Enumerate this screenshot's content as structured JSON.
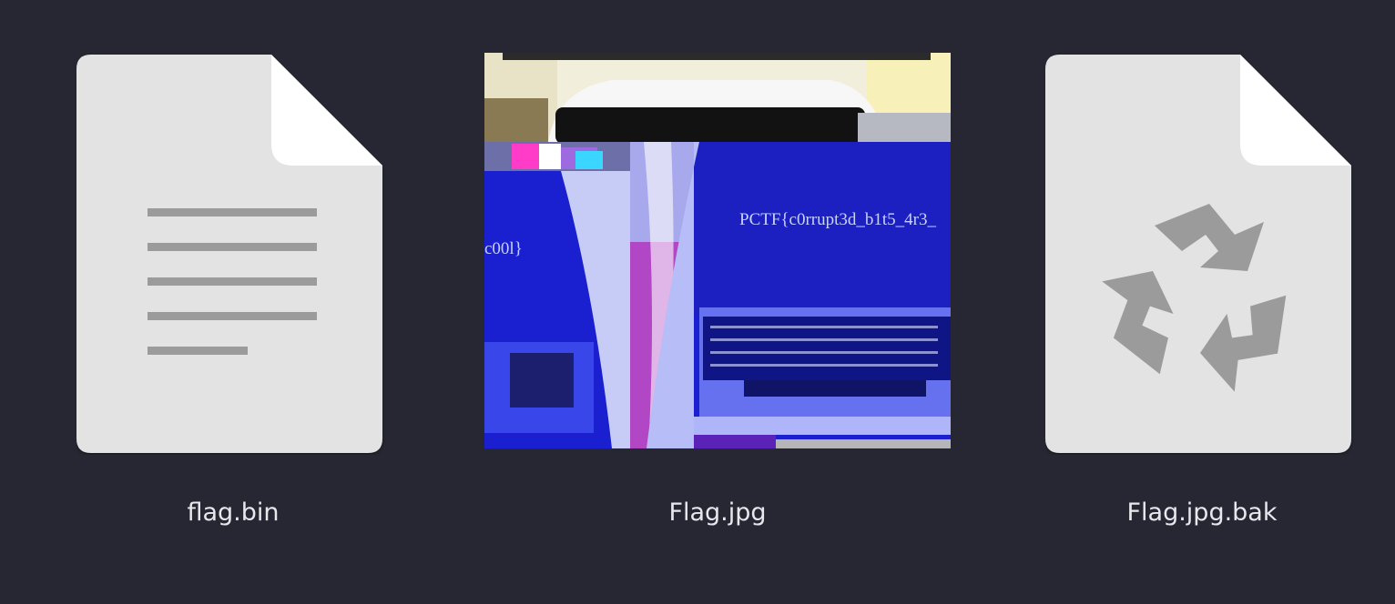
{
  "files": [
    {
      "name": "flag.bin",
      "icon": "text-document-icon"
    },
    {
      "name": "Flag.jpg",
      "icon": "image-thumbnail",
      "visible_text": [
        "PCTF{c0rrupt3d_b1t5_4r3_",
        "c00l}"
      ]
    },
    {
      "name": "Flag.jpg.bak",
      "icon": "recycle-document-icon"
    }
  ],
  "colors": {
    "background": "#262733",
    "document": "#e3e3e3",
    "document_fold": "#ffffff",
    "glyph": "#9b9b9b",
    "label": "#e8e8ec"
  }
}
